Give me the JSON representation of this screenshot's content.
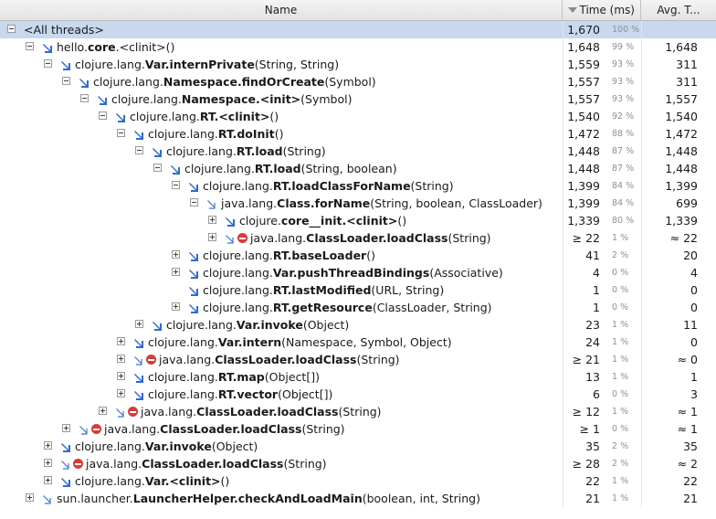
{
  "columns": {
    "name": "Name",
    "time": "Time (ms)",
    "avg": "Avg. T..."
  },
  "rows": [
    {
      "depth": 0,
      "toggle": "minus",
      "icon": "none",
      "stop": false,
      "pre": "<All threads>",
      "bold": "",
      "post": "",
      "time": "1,670",
      "pct": "100 %",
      "avg": "",
      "selected": true
    },
    {
      "depth": 1,
      "toggle": "minus",
      "icon": "solid",
      "stop": false,
      "pre": "hello.",
      "bold": "core",
      "post": ".<clinit>()",
      "time": "1,648",
      "pct": "99 %",
      "avg": "1,648"
    },
    {
      "depth": 2,
      "toggle": "minus",
      "icon": "solid",
      "stop": false,
      "pre": "clojure.lang.",
      "bold": "Var.internPrivate",
      "post": "(String, String)",
      "time": "1,559",
      "pct": "93 %",
      "avg": "311"
    },
    {
      "depth": 3,
      "toggle": "minus",
      "icon": "solid",
      "stop": false,
      "pre": "clojure.lang.",
      "bold": "Namespace.findOrCreate",
      "post": "(Symbol)",
      "time": "1,557",
      "pct": "93 %",
      "avg": "311"
    },
    {
      "depth": 4,
      "toggle": "minus",
      "icon": "solid",
      "stop": false,
      "pre": "clojure.lang.",
      "bold": "Namespace.<init>",
      "post": "(Symbol)",
      "time": "1,557",
      "pct": "93 %",
      "avg": "1,557"
    },
    {
      "depth": 5,
      "toggle": "minus",
      "icon": "solid",
      "stop": false,
      "pre": "clojure.lang.",
      "bold": "RT.<clinit>",
      "post": "()",
      "time": "1,540",
      "pct": "92 %",
      "avg": "1,540"
    },
    {
      "depth": 6,
      "toggle": "minus",
      "icon": "solid",
      "stop": false,
      "pre": "clojure.lang.",
      "bold": "RT.doInit",
      "post": "()",
      "time": "1,472",
      "pct": "88 %",
      "avg": "1,472"
    },
    {
      "depth": 7,
      "toggle": "minus",
      "icon": "solid",
      "stop": false,
      "pre": "clojure.lang.",
      "bold": "RT.load",
      "post": "(String)",
      "time": "1,448",
      "pct": "87 %",
      "avg": "1,448"
    },
    {
      "depth": 8,
      "toggle": "minus",
      "icon": "solid",
      "stop": false,
      "pre": "clojure.lang.",
      "bold": "RT.load",
      "post": "(String, boolean)",
      "time": "1,448",
      "pct": "87 %",
      "avg": "1,448"
    },
    {
      "depth": 9,
      "toggle": "minus",
      "icon": "solid",
      "stop": false,
      "pre": "clojure.lang.",
      "bold": "RT.loadClassForName",
      "post": "(String)",
      "time": "1,399",
      "pct": "84 %",
      "avg": "1,399"
    },
    {
      "depth": 10,
      "toggle": "minus",
      "icon": "outline",
      "stop": false,
      "pre": "java.lang.",
      "bold": "Class.forName",
      "post": "(String, boolean, ClassLoader)",
      "time": "1,399",
      "pct": "84 %",
      "avg": "699"
    },
    {
      "depth": 11,
      "toggle": "plus",
      "icon": "solid",
      "stop": false,
      "pre": "clojure.",
      "bold": "core__init.<clinit>",
      "post": "()",
      "time": "1,339",
      "pct": "80 %",
      "avg": "1,339"
    },
    {
      "depth": 11,
      "toggle": "plus",
      "icon": "outline",
      "stop": true,
      "pre": "java.lang.",
      "bold": "ClassLoader.loadClass",
      "post": "(String)",
      "time": "≥ 22",
      "pct": "1 %",
      "avg": "≈ 22"
    },
    {
      "depth": 9,
      "toggle": "plus",
      "icon": "solid",
      "stop": false,
      "pre": "clojure.lang.",
      "bold": "RT.baseLoader",
      "post": "()",
      "time": "41",
      "pct": "2 %",
      "avg": "20"
    },
    {
      "depth": 9,
      "toggle": "plus",
      "icon": "solid",
      "stop": false,
      "pre": "clojure.lang.",
      "bold": "Var.pushThreadBindings",
      "post": "(Associative)",
      "time": "4",
      "pct": "0 %",
      "avg": "4"
    },
    {
      "depth": 9,
      "toggle": "none",
      "icon": "solid",
      "stop": false,
      "pre": "clojure.lang.",
      "bold": "RT.lastModified",
      "post": "(URL, String)",
      "time": "1",
      "pct": "0 %",
      "avg": "0"
    },
    {
      "depth": 9,
      "toggle": "plus",
      "icon": "solid",
      "stop": false,
      "pre": "clojure.lang.",
      "bold": "RT.getResource",
      "post": "(ClassLoader, String)",
      "time": "1",
      "pct": "0 %",
      "avg": "0"
    },
    {
      "depth": 7,
      "toggle": "plus",
      "icon": "solid",
      "stop": false,
      "pre": "clojure.lang.",
      "bold": "Var.invoke",
      "post": "(Object)",
      "time": "23",
      "pct": "1 %",
      "avg": "11"
    },
    {
      "depth": 6,
      "toggle": "plus",
      "icon": "solid",
      "stop": false,
      "pre": "clojure.lang.",
      "bold": "Var.intern",
      "post": "(Namespace, Symbol, Object)",
      "time": "24",
      "pct": "1 %",
      "avg": "0"
    },
    {
      "depth": 6,
      "toggle": "plus",
      "icon": "outline",
      "stop": true,
      "pre": "java.lang.",
      "bold": "ClassLoader.loadClass",
      "post": "(String)",
      "time": "≥ 21",
      "pct": "1 %",
      "avg": "≈ 0"
    },
    {
      "depth": 6,
      "toggle": "plus",
      "icon": "solid",
      "stop": false,
      "pre": "clojure.lang.",
      "bold": "RT.map",
      "post": "(Object[])",
      "time": "13",
      "pct": "1 %",
      "avg": "1"
    },
    {
      "depth": 6,
      "toggle": "plus",
      "icon": "solid",
      "stop": false,
      "pre": "clojure.lang.",
      "bold": "RT.vector",
      "post": "(Object[])",
      "time": "6",
      "pct": "0 %",
      "avg": "3"
    },
    {
      "depth": 5,
      "toggle": "plus",
      "icon": "outline",
      "stop": true,
      "pre": "java.lang.",
      "bold": "ClassLoader.loadClass",
      "post": "(String)",
      "time": "≥ 12",
      "pct": "1 %",
      "avg": "≈ 1"
    },
    {
      "depth": 3,
      "toggle": "plus",
      "icon": "outline",
      "stop": true,
      "pre": "java.lang.",
      "bold": "ClassLoader.loadClass",
      "post": "(String)",
      "time": "≥ 1",
      "pct": "0 %",
      "avg": "≈ 1"
    },
    {
      "depth": 2,
      "toggle": "plus",
      "icon": "solid",
      "stop": false,
      "pre": "clojure.lang.",
      "bold": "Var.invoke",
      "post": "(Object)",
      "time": "35",
      "pct": "2 %",
      "avg": "35"
    },
    {
      "depth": 2,
      "toggle": "plus",
      "icon": "outline",
      "stop": true,
      "pre": "java.lang.",
      "bold": "ClassLoader.loadClass",
      "post": "(String)",
      "time": "≥ 28",
      "pct": "2 %",
      "avg": "≈ 2"
    },
    {
      "depth": 2,
      "toggle": "plus",
      "icon": "solid",
      "stop": false,
      "pre": "clojure.lang.",
      "bold": "Var.<clinit>",
      "post": "()",
      "time": "22",
      "pct": "1 %",
      "avg": "22"
    },
    {
      "depth": 1,
      "toggle": "plus",
      "icon": "outline",
      "stop": false,
      "pre": "sun.launcher.",
      "bold": "LauncherHelper.checkAndLoadMain",
      "post": "(boolean, int, String)",
      "time": "21",
      "pct": "1 %",
      "avg": "21"
    }
  ],
  "colors": {
    "selected_row": "#c7d8ef",
    "arrow_solid": "#2f6bd4",
    "arrow_outline": "#3b74d6",
    "stop_icon": "#d93a3a"
  }
}
